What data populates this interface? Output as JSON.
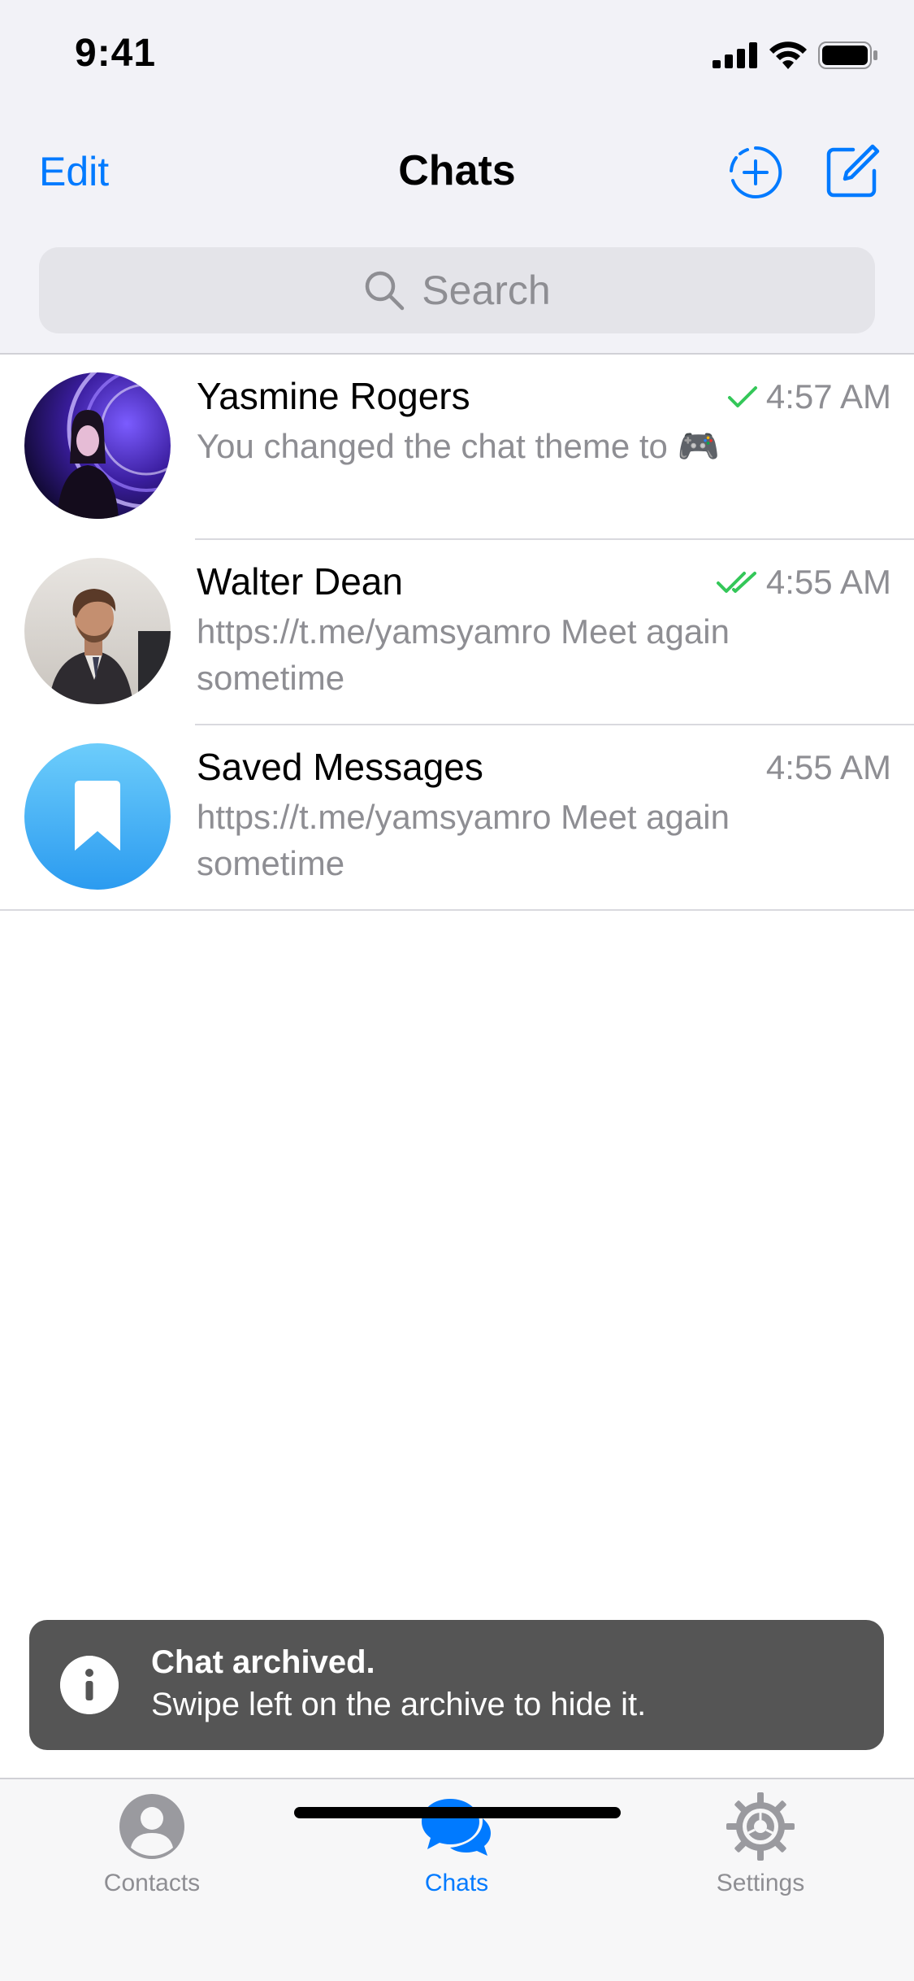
{
  "status_bar": {
    "time": "9:41"
  },
  "nav": {
    "edit_label": "Edit",
    "title": "Chats"
  },
  "search": {
    "placeholder": "Search"
  },
  "chats": [
    {
      "name": "Yasmine Rogers",
      "time": "4:57 AM",
      "preview": "You changed the chat theme to 🎮",
      "read_status": "sent"
    },
    {
      "name": "Walter Dean",
      "time": "4:55 AM",
      "preview": "https://t.me/yamsyamro Meet again sometime",
      "read_status": "read"
    },
    {
      "name": "Saved Messages",
      "time": "4:55 AM",
      "preview": "https://t.me/yamsyamro Meet again sometime",
      "read_status": "none"
    }
  ],
  "toast": {
    "title": "Chat archived.",
    "message": "Swipe left on the archive to hide it."
  },
  "tabs": [
    {
      "label": "Contacts",
      "icon": "person-circle-icon",
      "active": false
    },
    {
      "label": "Chats",
      "icon": "chat-bubbles-icon",
      "active": true
    },
    {
      "label": "Settings",
      "icon": "gear-icon",
      "active": false
    }
  ],
  "colors": {
    "accent": "#007aff",
    "check_green": "#34c759",
    "toast_bg": "#555555"
  }
}
